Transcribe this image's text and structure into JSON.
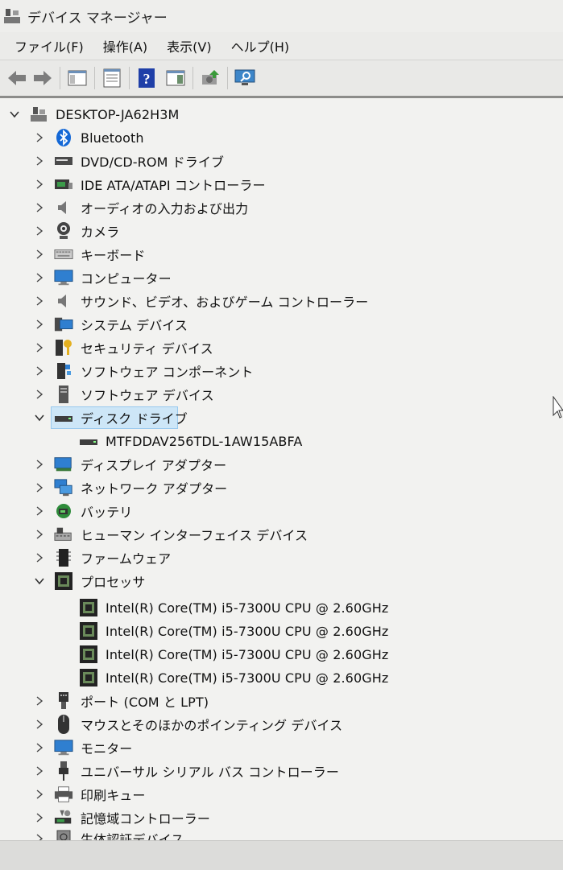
{
  "window": {
    "title": "デバイス マネージャー",
    "title_icon": "device-manager-icon"
  },
  "menu": [
    {
      "label": "ファイル(F)"
    },
    {
      "label": "操作(A)"
    },
    {
      "label": "表示(V)"
    },
    {
      "label": "ヘルプ(H)"
    }
  ],
  "toolbar": [
    {
      "icon": "back-arrow-icon"
    },
    {
      "icon": "forward-arrow-icon"
    },
    {
      "icon": "show-hide-console-tree-icon"
    },
    {
      "icon": "properties-icon"
    },
    {
      "icon": "help-icon"
    },
    {
      "icon": "action-pane-icon"
    },
    {
      "icon": "update-driver-icon"
    },
    {
      "icon": "scan-hardware-icon"
    }
  ],
  "tree": {
    "root": {
      "label": "DESKTOP-JA62H3M",
      "icon": "computer-tree-icon",
      "expanded": true
    },
    "categories": [
      {
        "label": "Bluetooth",
        "icon": "bluetooth-icon",
        "expanded": false
      },
      {
        "label": "DVD/CD-ROM ドライブ",
        "icon": "dvd-drive-icon",
        "expanded": false
      },
      {
        "label": "IDE ATA/ATAPI コントローラー",
        "icon": "ide-controller-icon",
        "expanded": false
      },
      {
        "label": "オーディオの入力および出力",
        "icon": "speaker-icon",
        "expanded": false
      },
      {
        "label": "カメラ",
        "icon": "camera-icon",
        "expanded": false
      },
      {
        "label": "キーボード",
        "icon": "keyboard-icon",
        "expanded": false
      },
      {
        "label": "コンピューター",
        "icon": "monitor-icon",
        "expanded": false
      },
      {
        "label": "サウンド、ビデオ、およびゲーム コントローラー",
        "icon": "speaker-icon",
        "expanded": false
      },
      {
        "label": "システム デバイス",
        "icon": "system-devices-icon",
        "expanded": false
      },
      {
        "label": "セキュリティ デバイス",
        "icon": "security-key-icon",
        "expanded": false
      },
      {
        "label": "ソフトウェア コンポーネント",
        "icon": "software-component-icon",
        "expanded": false
      },
      {
        "label": "ソフトウェア デバイス",
        "icon": "software-device-icon",
        "expanded": false
      },
      {
        "label": "ディスク ドライブ",
        "icon": "disk-drive-icon",
        "expanded": true,
        "selected": true,
        "children": [
          {
            "label": "MTFDDAV256TDL-1AW15ABFA",
            "icon": "disk-drive-icon"
          }
        ]
      },
      {
        "label": "ディスプレイ アダプター",
        "icon": "display-adapter-icon",
        "expanded": false
      },
      {
        "label": "ネットワーク アダプター",
        "icon": "network-adapter-icon",
        "expanded": false
      },
      {
        "label": "バッテリ",
        "icon": "battery-icon",
        "expanded": false
      },
      {
        "label": "ヒューマン インターフェイス デバイス",
        "icon": "hid-icon",
        "expanded": false
      },
      {
        "label": "ファームウェア",
        "icon": "firmware-icon",
        "expanded": false
      },
      {
        "label": "プロセッサ",
        "icon": "processor-icon",
        "expanded": true,
        "children": [
          {
            "label": "Intel(R) Core(TM) i5-7300U CPU @ 2.60GHz",
            "icon": "processor-icon"
          },
          {
            "label": "Intel(R) Core(TM) i5-7300U CPU @ 2.60GHz",
            "icon": "processor-icon"
          },
          {
            "label": "Intel(R) Core(TM) i5-7300U CPU @ 2.60GHz",
            "icon": "processor-icon"
          },
          {
            "label": "Intel(R) Core(TM) i5-7300U CPU @ 2.60GHz",
            "icon": "processor-icon"
          }
        ]
      },
      {
        "label": "ポート (COM と LPT)",
        "icon": "port-icon",
        "expanded": false
      },
      {
        "label": "マウスとそのほかのポインティング デバイス",
        "icon": "mouse-icon",
        "expanded": false
      },
      {
        "label": "モニター",
        "icon": "monitor-icon",
        "expanded": false
      },
      {
        "label": "ユニバーサル シリアル バス コントローラー",
        "icon": "usb-icon",
        "expanded": false
      },
      {
        "label": "印刷キュー",
        "icon": "printer-icon",
        "expanded": false
      },
      {
        "label": "記憶域コントローラー",
        "icon": "storage-controller-icon",
        "expanded": false
      },
      {
        "label": "生体認証デバイス",
        "icon": "biometric-icon",
        "expanded": false
      }
    ]
  },
  "colors": {
    "selection_fill": "#cde6f7",
    "selection_border": "#99c9ee",
    "tree_background": "#f2f2f0"
  }
}
